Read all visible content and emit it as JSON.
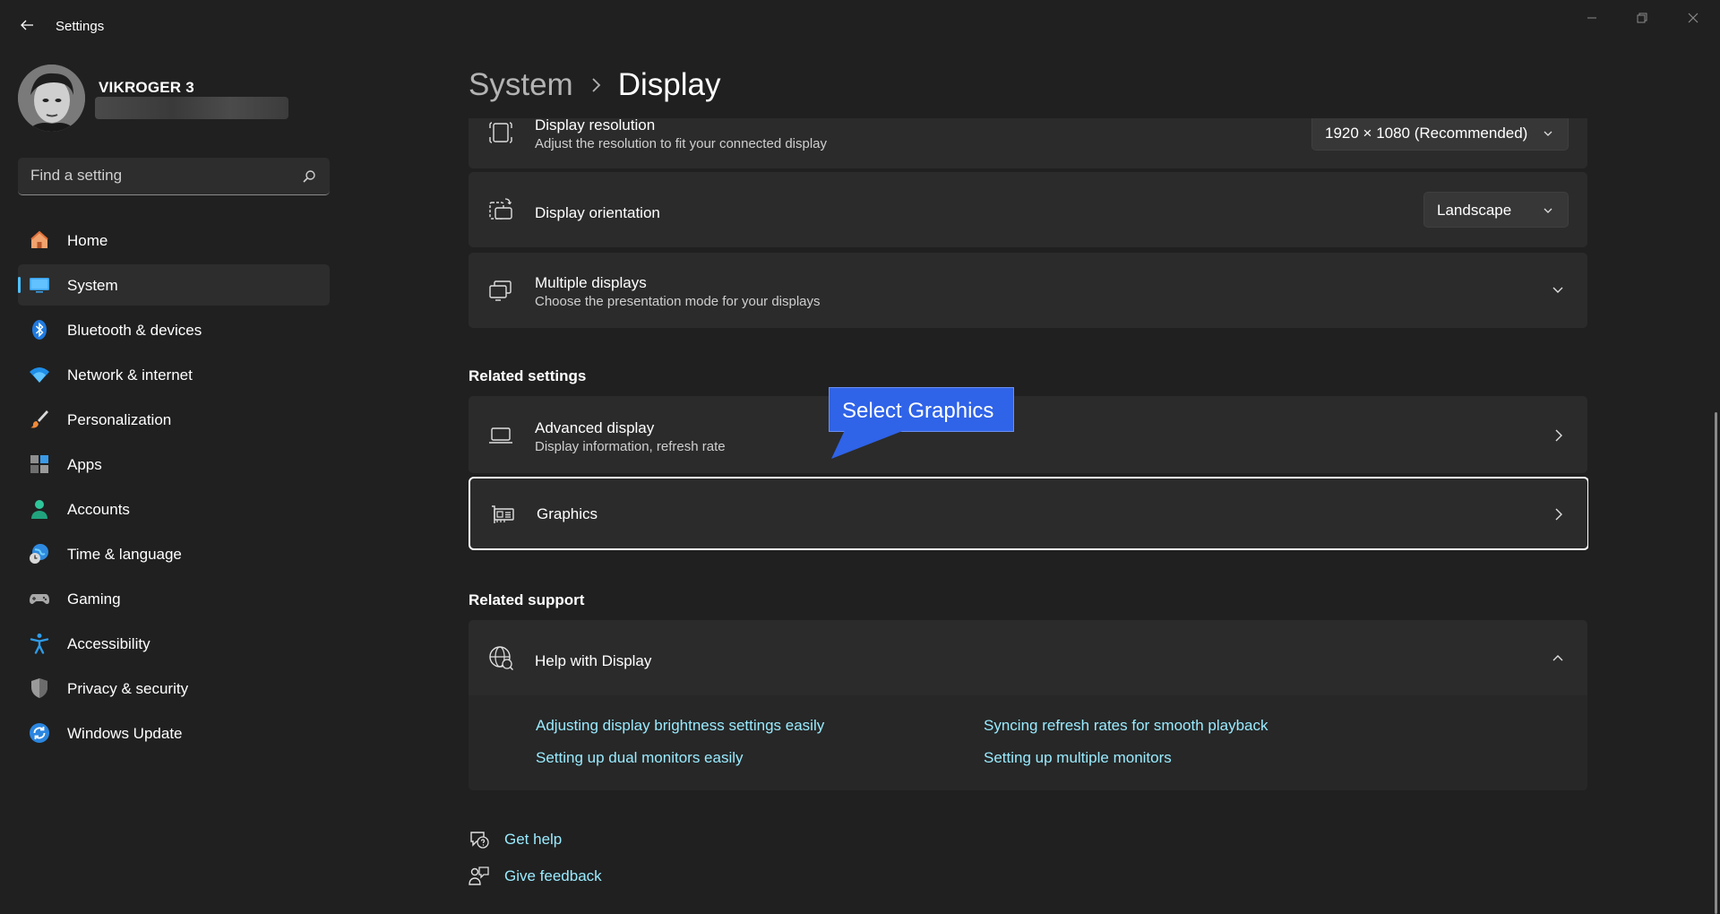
{
  "window": {
    "title": "Settings",
    "controls": [
      "minimize",
      "maximize",
      "close"
    ]
  },
  "profile": {
    "name": "VIKROGER 3"
  },
  "search": {
    "placeholder": "Find a setting",
    "value": ""
  },
  "sidebar": {
    "items": [
      {
        "label": "Home",
        "icon": "home-icon",
        "active": false
      },
      {
        "label": "System",
        "icon": "system-display-icon",
        "active": true
      },
      {
        "label": "Bluetooth & devices",
        "icon": "bluetooth-icon",
        "active": false
      },
      {
        "label": "Network & internet",
        "icon": "wifi-icon",
        "active": false
      },
      {
        "label": "Personalization",
        "icon": "brush-icon",
        "active": false
      },
      {
        "label": "Apps",
        "icon": "apps-icon",
        "active": false
      },
      {
        "label": "Accounts",
        "icon": "person-icon",
        "active": false
      },
      {
        "label": "Time & language",
        "icon": "globe-clock-icon",
        "active": false
      },
      {
        "label": "Gaming",
        "icon": "controller-icon",
        "active": false
      },
      {
        "label": "Accessibility",
        "icon": "accessibility-icon",
        "active": false
      },
      {
        "label": "Privacy & security",
        "icon": "shield-icon",
        "active": false
      },
      {
        "label": "Windows Update",
        "icon": "update-icon",
        "active": false
      }
    ]
  },
  "breadcrumb": {
    "parent": "System",
    "current": "Display"
  },
  "settings": {
    "resolution": {
      "title": "Display resolution",
      "subtitle": "Adjust the resolution to fit your connected display",
      "value": "1920 × 1080 (Recommended)"
    },
    "orientation": {
      "title": "Display orientation",
      "value": "Landscape"
    },
    "multiple": {
      "title": "Multiple displays",
      "subtitle": "Choose the presentation mode for your displays"
    }
  },
  "related_settings": {
    "heading": "Related settings",
    "advanced": {
      "title": "Advanced display",
      "subtitle": "Display information, refresh rate"
    },
    "graphics": {
      "title": "Graphics"
    }
  },
  "related_support": {
    "heading": "Related support",
    "help": {
      "title": "Help with Display",
      "links": [
        "Adjusting display brightness settings easily",
        "Syncing refresh rates for smooth playback",
        "Setting up dual monitors easily",
        "Setting up multiple monitors"
      ]
    }
  },
  "footer_links": {
    "get_help": "Get help",
    "give_feedback": "Give feedback"
  },
  "callout": {
    "text": "Select Graphics"
  },
  "colors": {
    "background": "#202020",
    "card": "#2b2b2b",
    "accent": "#4cc2ff",
    "link": "#99ebff",
    "callout": "#2f63e8"
  }
}
